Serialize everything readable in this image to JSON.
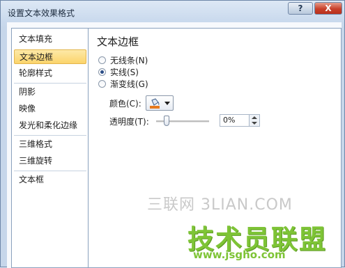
{
  "window": {
    "title": "设置文本效果格式",
    "help_label": "?",
    "close_label": "X"
  },
  "sidebar": {
    "items": [
      {
        "label": "文本填充",
        "selected": false
      },
      {
        "label": "文本边框",
        "selected": true
      },
      {
        "label": "轮廓样式",
        "selected": false
      },
      {
        "label": "阴影",
        "selected": false
      },
      {
        "label": "映像",
        "selected": false
      },
      {
        "label": "发光和柔化边缘",
        "selected": false
      },
      {
        "label": "三维格式",
        "selected": false
      },
      {
        "label": "三维旋转",
        "selected": false
      },
      {
        "label": "文本框",
        "selected": false
      }
    ]
  },
  "panel": {
    "title": "文本边框",
    "options": [
      {
        "label": "无线条(N)",
        "checked": false
      },
      {
        "label": "实线(S)",
        "checked": true
      },
      {
        "label": "渐变线(G)",
        "checked": false
      }
    ],
    "color_label": "颜色(C):",
    "transparency_label": "透明度(T):",
    "transparency_value": "0%",
    "transparency_fraction": 0.0
  },
  "watermark": {
    "line1": "三联网 3LIAN.COM",
    "line2": "技术员联盟",
    "line3": "www.jsgho.com"
  },
  "colors": {
    "selected_item_bg": "#fbd46b",
    "close_button": "#c8402a",
    "watermark_green": "#7ec436"
  }
}
